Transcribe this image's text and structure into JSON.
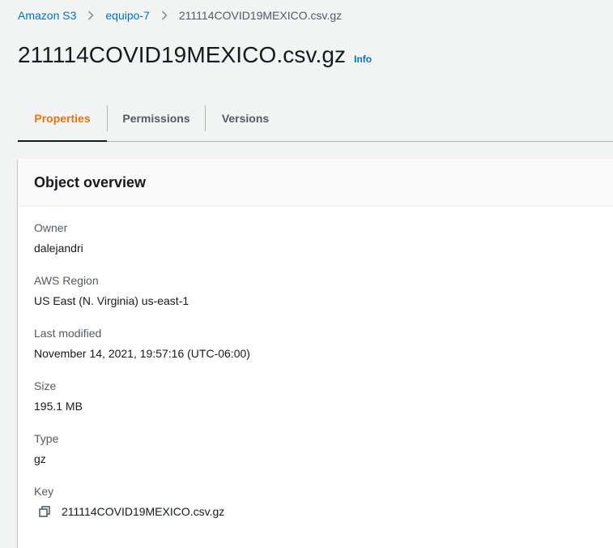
{
  "breadcrumb": {
    "items": [
      {
        "label": "Amazon S3"
      },
      {
        "label": "equipo-7"
      },
      {
        "label": "211114COVID19MEXICO.csv.gz"
      }
    ]
  },
  "header": {
    "title": "211114COVID19MEXICO.csv.gz",
    "info_link": "Info"
  },
  "tabs": [
    {
      "label": "Properties",
      "active": true
    },
    {
      "label": "Permissions",
      "active": false
    },
    {
      "label": "Versions",
      "active": false
    }
  ],
  "overview": {
    "title": "Object overview",
    "fields": [
      {
        "label": "Owner",
        "value": "dalejandri"
      },
      {
        "label": "AWS Region",
        "value": "US East (N. Virginia) us-east-1"
      },
      {
        "label": "Last modified",
        "value": "November 14, 2021, 19:57:16 (UTC-06:00)"
      },
      {
        "label": "Size",
        "value": "195.1 MB"
      },
      {
        "label": "Type",
        "value": "gz"
      },
      {
        "label": "Key",
        "value": "211114COVID19MEXICO.csv.gz",
        "icon": "copy-icon"
      }
    ]
  },
  "colors": {
    "link": "#0073bb",
    "active_tab": "#ec7211",
    "text": "#16191f",
    "muted": "#545b64",
    "background": "#f2f3f3"
  }
}
